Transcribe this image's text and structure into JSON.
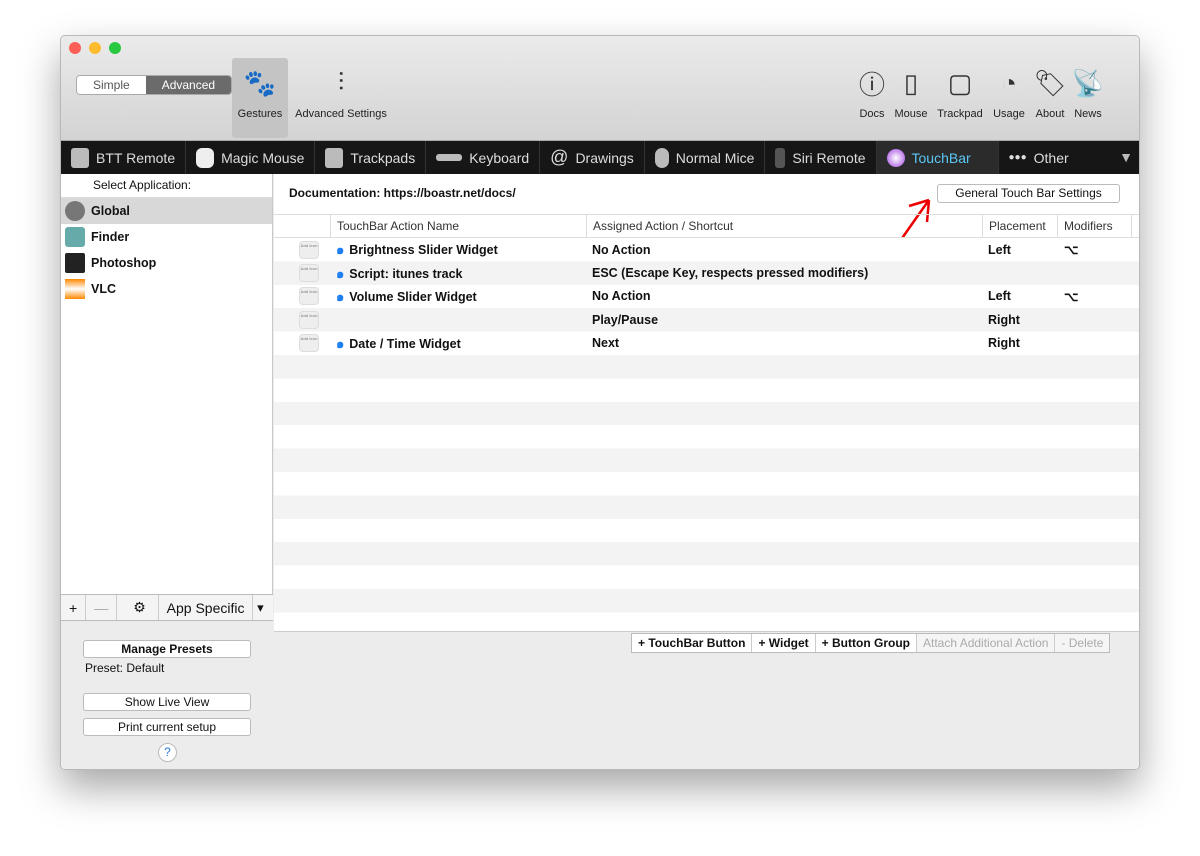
{
  "toolbar": {
    "mode": [
      "Simple",
      "Advanced"
    ],
    "gestures": "Gestures",
    "advanced_settings": "Advanced Settings",
    "right": [
      "Docs",
      "Mouse",
      "Trackpad",
      "Usage",
      "About",
      "News"
    ]
  },
  "tabs": [
    "BTT Remote",
    "Magic Mouse",
    "Trackpads",
    "Keyboard",
    "Drawings",
    "Normal Mice",
    "Siri Remote",
    "TouchBar",
    "Other"
  ],
  "sidebar": {
    "header": "Select Application:",
    "apps": [
      "Global",
      "Finder",
      "Photoshop",
      "VLC"
    ],
    "app_specific": "App Specific",
    "manage_presets": "Manage Presets",
    "preset": "Preset: Default",
    "show_live_view": "Show Live View",
    "print_setup": "Print current setup",
    "help": "?"
  },
  "main": {
    "documentation": "Documentation: https://boastr.net/docs/",
    "general_settings": "General Touch Bar Settings",
    "columns": [
      "TouchBar Action Name",
      "Assigned Action / Shortcut",
      "Placement",
      "Modifiers"
    ],
    "add_icon": "Add Icon",
    "rows": [
      {
        "name": "Brightness Slider Widget",
        "action": "No Action",
        "placement": "Left",
        "modifiers": "⌥"
      },
      {
        "name": "Script: itunes track",
        "action": "ESC (Escape Key, respects pressed modifiers)",
        "placement": "",
        "modifiers": ""
      },
      {
        "name": "Volume Slider Widget",
        "action": "No Action",
        "placement": "Left",
        "modifiers": "⌥"
      },
      {
        "name": "",
        "action": "Play/Pause",
        "placement": "Right",
        "modifiers": ""
      },
      {
        "name": "Date / Time Widget",
        "action": "Next",
        "placement": "Right",
        "modifiers": ""
      }
    ],
    "footer": [
      "+ TouchBar Button",
      "+ Widget",
      "+ Button Group",
      "Attach Additional Action",
      "- Delete"
    ]
  }
}
